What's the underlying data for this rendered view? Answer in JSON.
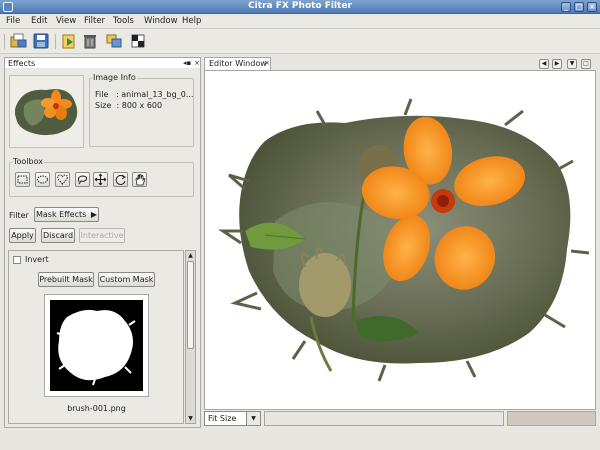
{
  "window": {
    "title": "Citra FX Photo Filter"
  },
  "menu": [
    {
      "label": "File"
    },
    {
      "label": "Edit"
    },
    {
      "label": "View"
    },
    {
      "label": "Filter"
    },
    {
      "label": "Tools"
    },
    {
      "label": "Window"
    },
    {
      "label": "Help"
    }
  ],
  "toolbar": {
    "icons": [
      "open-icon",
      "save-icon",
      "import-icon",
      "trash-icon",
      "copy-icon",
      "checker-icon"
    ]
  },
  "effects_panel": {
    "tab_label": "Effects",
    "image_info": {
      "title": "Image Info",
      "file_line": "File   : animal_13_bg_0...",
      "size_line": "Size  : 800 x 600"
    },
    "toolbox_title": "Toolbox",
    "tools": [
      "rect-select-icon",
      "ellipse-select-icon",
      "heart-select-icon",
      "lasso-icon",
      "move-icon",
      "rotate-icon",
      "hand-icon"
    ],
    "filter_label": "Filter",
    "filter_value": "Mask Effects",
    "apply_label": "Apply",
    "discard_label": "Discard",
    "interactive_label": "Interactive",
    "invert_label": "Invert",
    "invert_checked": false,
    "prebuilt_mask_label": "Prebuilt Mask",
    "custom_mask_label": "Custom Mask",
    "mask_filename": "brush-001.png"
  },
  "editor": {
    "tab_label": "Editor Window",
    "zoom_value": "Fit Size"
  },
  "colors": {
    "titlebar": "#5a84bb",
    "petal": "#f08a1c",
    "panel": "#ebe9e4"
  }
}
